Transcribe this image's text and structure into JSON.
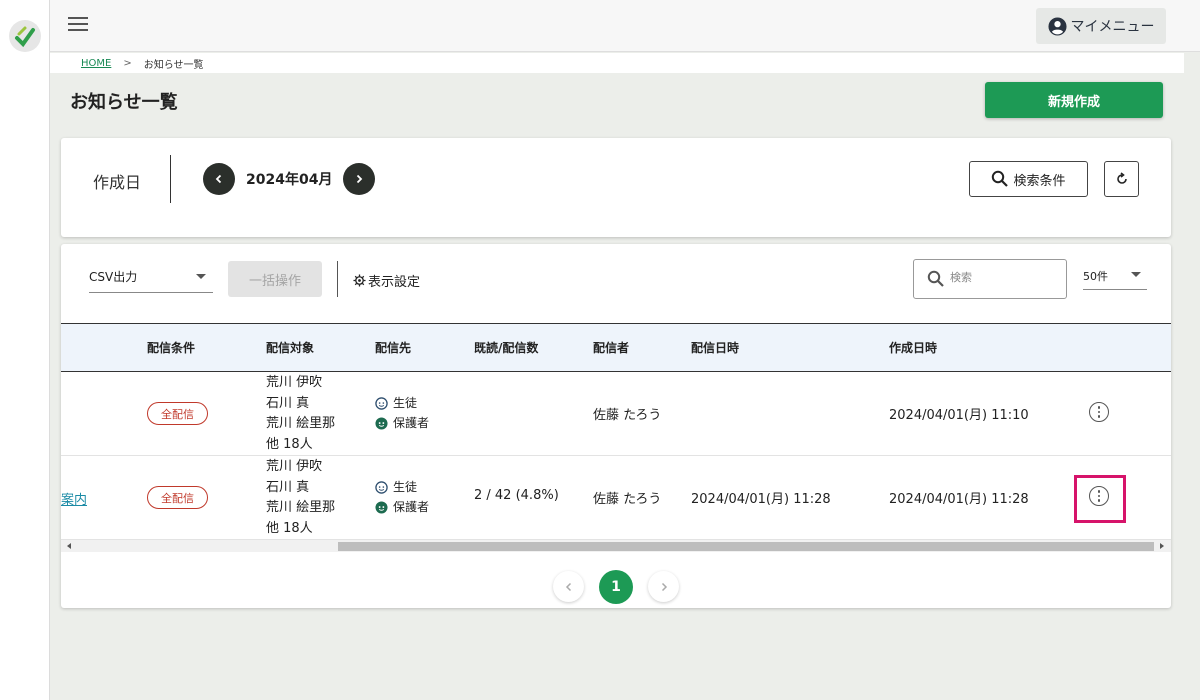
{
  "header": {
    "mymenu_label": "マイメニュー"
  },
  "breadcrumb": {
    "home": "HOME",
    "separator": ">",
    "current": "お知らせ一覧"
  },
  "page": {
    "title": "お知らせ一覧",
    "new_button": "新規作成"
  },
  "filter": {
    "label": "作成日",
    "month": "2024年04月",
    "search_conditions_button": "検索条件"
  },
  "toolbar": {
    "csv_label": "CSV出力",
    "bulk_button": "一括操作",
    "display_settings": "表示設定",
    "search_placeholder": "検索",
    "per_page": "50件"
  },
  "table": {
    "headers": [
      "配信条件",
      "配信対象",
      "配信先",
      "既読/配信数",
      "配信者",
      "配信日時",
      "作成日時"
    ],
    "rows": [
      {
        "title_fragment": "",
        "condition": "全配信",
        "targets": [
          "荒川 伊吹",
          "石川 真",
          "荒川 絵里那",
          "他  18人"
        ],
        "destinations": [
          "生徒",
          "保護者"
        ],
        "read_count": "",
        "sender": "佐藤 たろう",
        "sent_at": "",
        "created_at": "2024/04/01(月) 11:10"
      },
      {
        "title_fragment": "案内",
        "condition": "全配信",
        "targets": [
          "荒川 伊吹",
          "石川 真",
          "荒川 絵里那",
          "他  18人"
        ],
        "destinations": [
          "生徒",
          "保護者"
        ],
        "read_count": "2 / 42 (4.8%)",
        "sender": "佐藤 たろう",
        "sent_at": "2024/04/01(月) 11:28",
        "created_at": "2024/04/01(月) 11:28"
      }
    ]
  },
  "pagination": {
    "current": "1"
  },
  "colors": {
    "accent_green": "#1d9a55",
    "badge_red": "#c0392b",
    "highlight": "#d6136a"
  }
}
